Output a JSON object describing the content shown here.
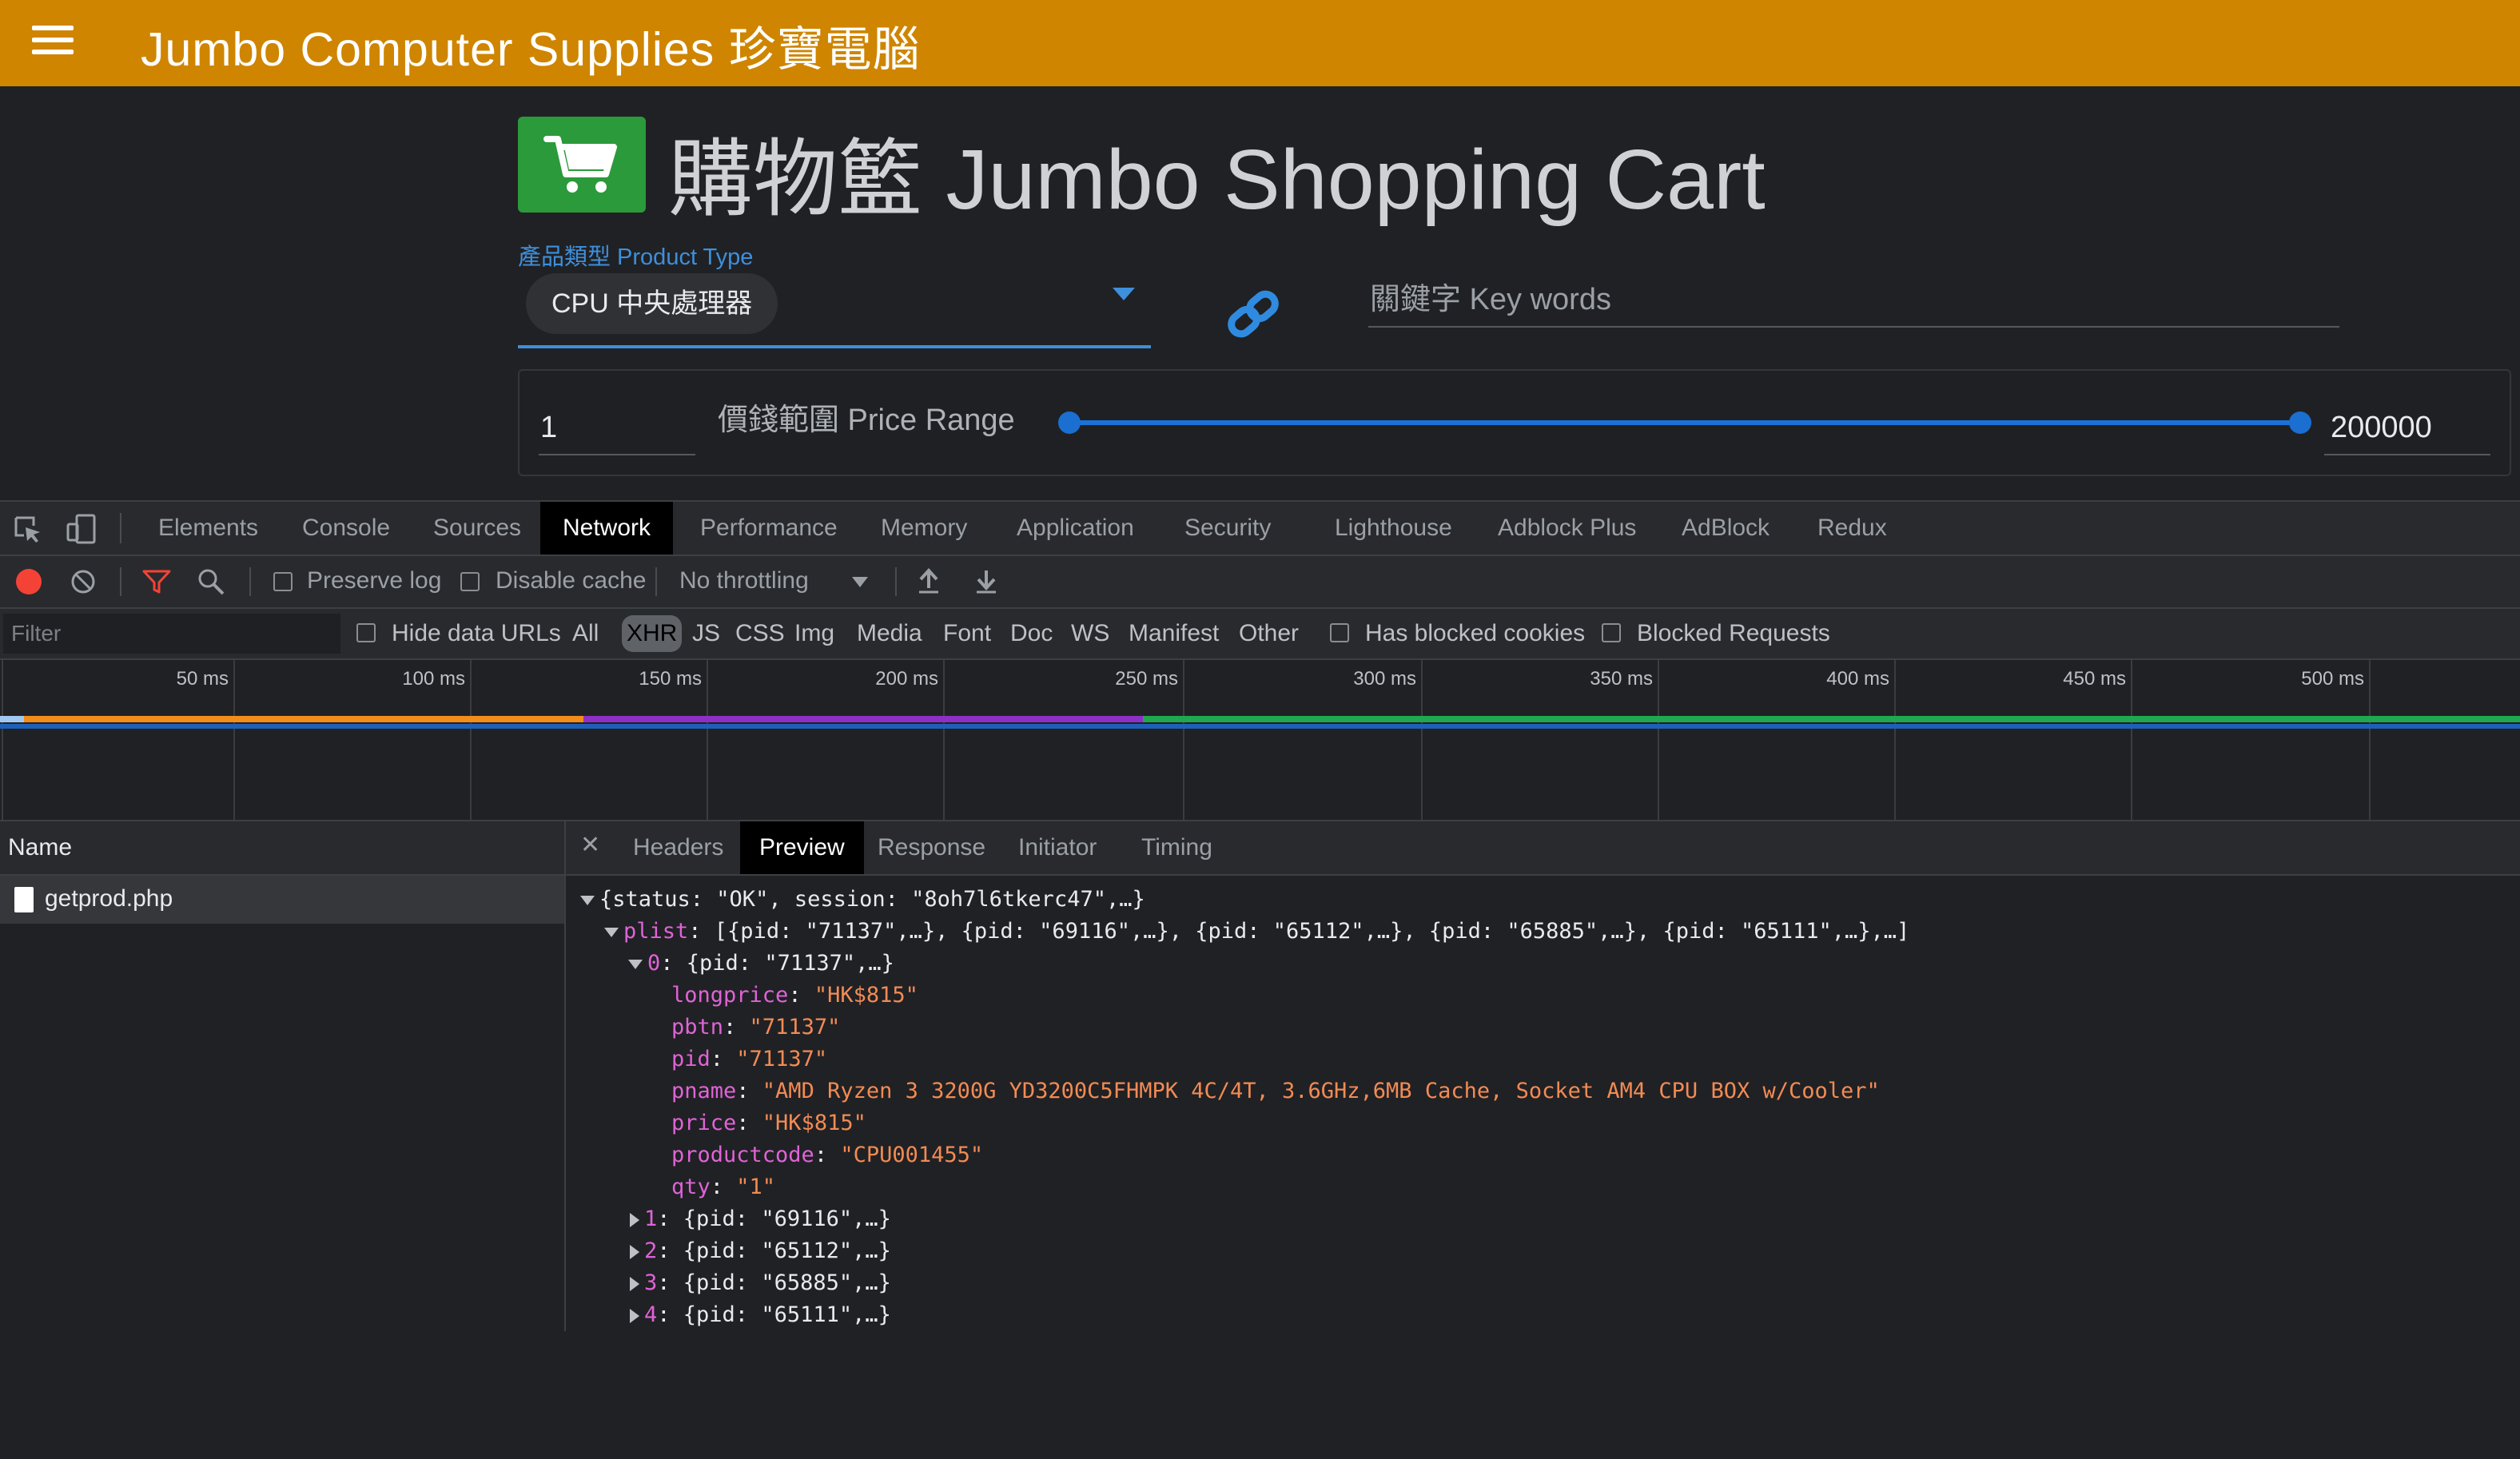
{
  "app_bar": {
    "title": "Jumbo Computer Supplies 珍寶電腦"
  },
  "page": {
    "title": "購物籃 Jumbo Shopping Cart"
  },
  "filters": {
    "product_type_label": "產品類型 Product Type",
    "product_type_value": "CPU 中央處理器",
    "keywords_placeholder": "關鍵字 Key words",
    "price_range_label": "價錢範圍 Price Range",
    "price_min": "1",
    "price_max": "200000"
  },
  "devtools": {
    "tabs": [
      "Elements",
      "Console",
      "Sources",
      "Network",
      "Performance",
      "Memory",
      "Application",
      "Security",
      "Lighthouse",
      "Adblock Plus",
      "AdBlock",
      "Redux"
    ],
    "active_tab": "Network",
    "toolbar": {
      "preserve_log": "Preserve log",
      "disable_cache": "Disable cache",
      "throttling": "No throttling"
    },
    "filterbar": {
      "filter_placeholder": "Filter",
      "hide_data_urls": "Hide data URLs",
      "types": [
        "All",
        "XHR",
        "JS",
        "CSS",
        "Img",
        "Media",
        "Font",
        "Doc",
        "WS",
        "Manifest",
        "Other"
      ],
      "active_type": "XHR",
      "has_blocked_cookies": "Has blocked cookies",
      "blocked_requests": "Blocked Requests"
    },
    "timeline": {
      "ticks": [
        "50 ms",
        "100 ms",
        "150 ms",
        "200 ms",
        "250 ms",
        "300 ms",
        "350 ms",
        "400 ms",
        "450 ms",
        "500 ms"
      ]
    },
    "requests": {
      "header": "Name",
      "items": [
        "getprod.php"
      ]
    },
    "detail_tabs": [
      "Headers",
      "Preview",
      "Response",
      "Initiator",
      "Timing"
    ],
    "active_detail_tab": "Preview",
    "preview": {
      "root": "{status: \"OK\", session: \"8oh7l6tkerc47\",…}",
      "plist_key": "plist",
      "plist_summary": "[{pid: \"71137\",…}, {pid: \"69116\",…}, {pid: \"65112\",…}, {pid: \"65885\",…}, {pid: \"65111\",…},…]",
      "item0_header": "{pid: \"71137\",…}",
      "item0_fields": [
        {
          "key": "longprice",
          "value": "\"HK$815\""
        },
        {
          "key": "pbtn",
          "value": "\"71137\""
        },
        {
          "key": "pid",
          "value": "\"71137\""
        },
        {
          "key": "pname",
          "value": "\"AMD Ryzen 3 3200G YD3200C5FHMPK 4C/4T, 3.6GHz,6MB Cache, Socket AM4 CPU BOX w/Cooler\""
        },
        {
          "key": "price",
          "value": "\"HK$815\""
        },
        {
          "key": "productcode",
          "value": "\"CPU001455\""
        },
        {
          "key": "qty",
          "value": "\"1\""
        }
      ],
      "collapsed_items": [
        {
          "index": "1",
          "summary": "{pid: \"69116\",…}"
        },
        {
          "index": "2",
          "summary": "{pid: \"65112\",…}"
        },
        {
          "index": "3",
          "summary": "{pid: \"65885\",…}"
        },
        {
          "index": "4",
          "summary": "{pid: \"65111\",…}"
        }
      ]
    }
  }
}
